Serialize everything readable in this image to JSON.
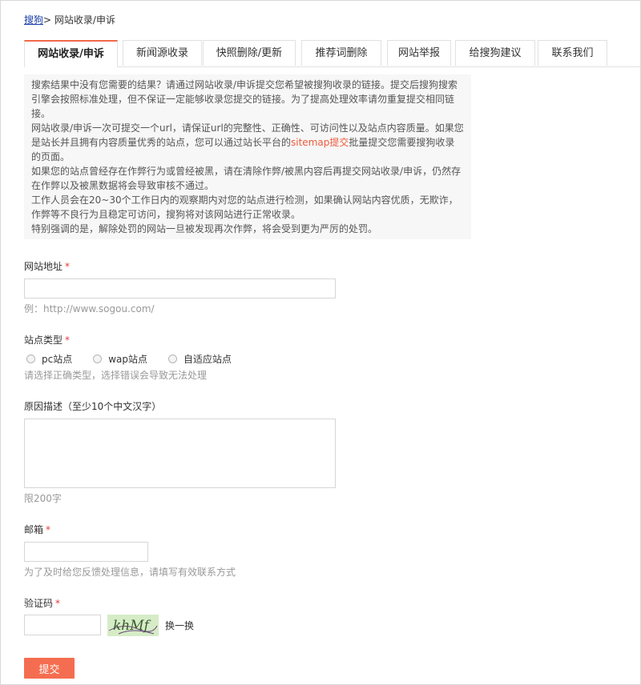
{
  "breadcrumb": {
    "home": "搜狗",
    "separator": ">",
    "current": "网站收录/申诉"
  },
  "tabs": [
    {
      "label": "网站收录/申诉",
      "active": true
    },
    {
      "label": "新闻源收录"
    },
    {
      "label": "快照删除/更新"
    },
    {
      "label": "推荐词删除"
    },
    {
      "label": "网站举报"
    },
    {
      "label": "给搜狗建议"
    },
    {
      "label": "联系我们"
    }
  ],
  "notice": {
    "p1": "搜索结果中没有您需要的结果？请通过网站收录/申诉提交您希望被搜狗收录的链接。提交后搜狗搜索引擎会按照标准处理，但不保证一定能够收录您提交的链接。为了提高处理效率请勿重复提交相同链接。",
    "p2_before": "网站收录/申诉一次可提交一个url，请保证url的完整性、正确性、可访问性以及站点内容质量。如果您是站长并且拥有内容质量优秀的站点，您可以通过站长平台的",
    "p2_link": "sitemap提交",
    "p2_after": "批量提交您需要搜狗收录的页面。",
    "p3": "如果您的站点曾经存在作弊行为或曾经被黑，请在清除作弊/被黑内容后再提交网站收录/申诉，仍然存在作弊以及被黑数据将会导致审核不通过。",
    "p4": "工作人员会在20~30个工作日内的观察期内对您的站点进行检测，如果确认网站内容优质，无欺诈，作弊等不良行为且稳定可访问，搜狗将对该网站进行正常收录。",
    "p5": "特别强调的是，解除处罚的网站一旦被发现再次作弊，将会受到更为严厉的处罚。"
  },
  "form": {
    "url_label": "网站地址",
    "url_value": "",
    "url_hint": "例：http://www.sogou.com/",
    "type_label": "站点类型",
    "type_options": [
      "pc站点",
      "wap站点",
      "自适应站点"
    ],
    "type_hint": "请选择正确类型，选择错误会导致无法处理",
    "reason_label": "原因描述（至少10个中文汉字）",
    "reason_value": "",
    "reason_hint": "限200字",
    "email_label": "邮箱",
    "email_value": "",
    "email_hint": "为了及时给您反馈处理信息，请填写有效联系方式",
    "captcha_label": "验证码",
    "captcha_value": "",
    "captcha_text": "khMf",
    "captcha_refresh": "换一换",
    "required_mark": "*",
    "submit_label": "提交"
  },
  "colors": {
    "accent": "#f56d50",
    "required": "#e4393c",
    "link": "#1a3ea8",
    "notice_bg": "#f7f7f7",
    "captcha_bg": "#d6ecc7"
  }
}
